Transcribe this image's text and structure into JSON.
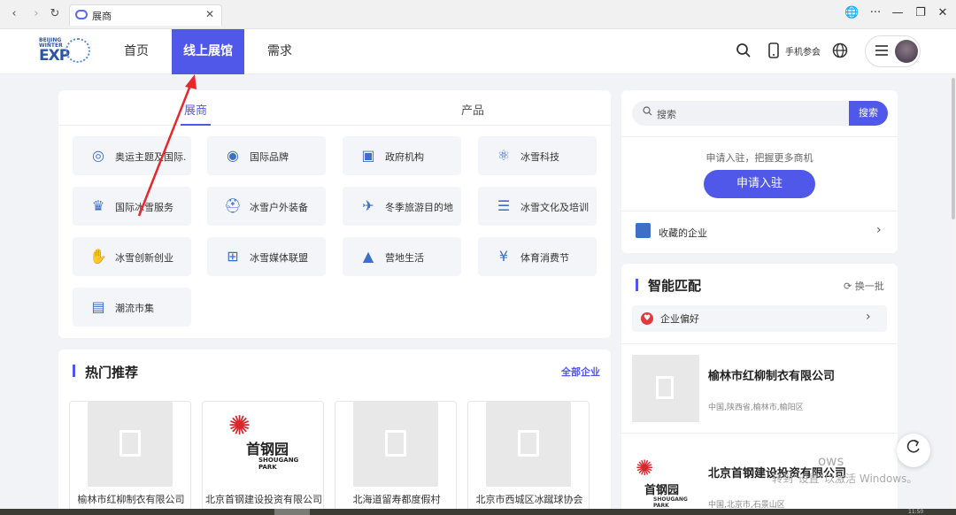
{
  "browser": {
    "tab_title": "展商",
    "controls": {
      "back": "‹",
      "forward": "›",
      "reload": "↻",
      "close": "✕",
      "globe": "🌐",
      "more": "···",
      "minimize": "—",
      "restore": "❐",
      "win_close": "✕"
    }
  },
  "nav": {
    "logo_text": "EXP",
    "logo_small": "BEIJING WINTER",
    "items": [
      {
        "label": "首页",
        "active": false
      },
      {
        "label": "线上展馆",
        "active": true
      },
      {
        "label": "需求",
        "active": false
      }
    ],
    "mobile_label": "手机参会"
  },
  "exhibitors": {
    "tabs": [
      {
        "label": "展商",
        "active": true
      },
      {
        "label": "产品",
        "active": false
      }
    ],
    "categories": [
      {
        "label": "奥运主题及国际...",
        "icon": "olympic-rings-icon",
        "glyph": "◎"
      },
      {
        "label": "国际品牌",
        "icon": "globe-icon",
        "glyph": "◉"
      },
      {
        "label": "政府机构",
        "icon": "emblem-icon",
        "glyph": "▣"
      },
      {
        "label": "冰雪科技",
        "icon": "molecule-icon",
        "glyph": "⚛"
      },
      {
        "label": "国际冰雪服务",
        "icon": "podium-icon",
        "glyph": "♛"
      },
      {
        "label": "冰雪户外装备",
        "icon": "gear-pack-icon",
        "glyph": "⛑"
      },
      {
        "label": "冬季旅游目的地",
        "icon": "travel-icon",
        "glyph": "✈"
      },
      {
        "label": "冰雪文化及培训",
        "icon": "training-icon",
        "glyph": "☰"
      },
      {
        "label": "冰雪创新创业",
        "icon": "innovation-icon",
        "glyph": "✋"
      },
      {
        "label": "冰雪媒体联盟",
        "icon": "news-icon",
        "glyph": "⊞"
      },
      {
        "label": "营地生活",
        "icon": "tent-icon",
        "glyph": "▲"
      },
      {
        "label": "体育消费节",
        "icon": "consumer-icon",
        "glyph": "¥"
      },
      {
        "label": "潮流市集",
        "icon": "market-icon",
        "glyph": "▤"
      }
    ]
  },
  "hot": {
    "title": "热门推荐",
    "all_label": "全部企业",
    "cards": [
      {
        "name": "榆林市红柳制衣有限公司",
        "logo": "placeholder"
      },
      {
        "name": "北京首钢建设投资有限公司",
        "logo": "shougang"
      },
      {
        "name": "北海道留寿都度假村",
        "logo": "placeholder"
      },
      {
        "name": "北京市西城区冰蹴球协会",
        "logo": "placeholder"
      }
    ]
  },
  "shougang_logo": {
    "name": "首钢园",
    "sub1": "SHOUGANG",
    "sub2": "PARK"
  },
  "sidebar": {
    "search_placeholder": "搜索",
    "search_button": "搜索",
    "hint": "申请入驻，把握更多商机",
    "apply_button": "申请入驻",
    "favorites_label": "收藏的企业"
  },
  "smart": {
    "title": "智能匹配",
    "refresh_label": "换一批",
    "preference_label": "企业偏好",
    "companies": [
      {
        "name": "榆林市红柳制衣有限公司",
        "location": "中国,陕西省,榆林市,榆阳区",
        "logo": "placeholder"
      },
      {
        "name": "北京首钢建设投资有限公司",
        "location": "中国,北京市,石景山区",
        "logo": "shougang"
      }
    ]
  },
  "watermark": {
    "line1": "ows",
    "line2": "转到\"设置\"以激活 Windows。"
  },
  "taskbar": {
    "clock": "11:50"
  },
  "colors": {
    "accent": "#4f58e8",
    "annotation_arrow": "#e8262b"
  }
}
